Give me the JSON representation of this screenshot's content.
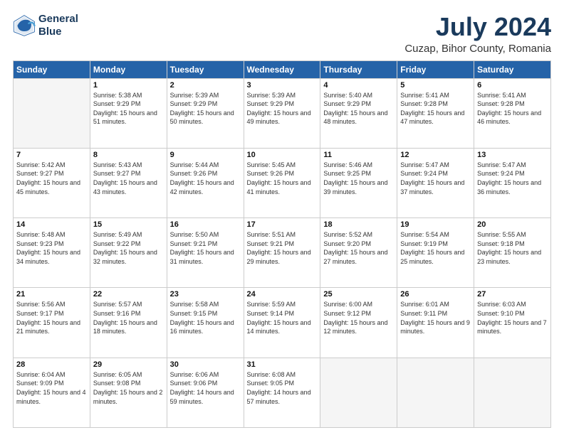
{
  "logo": {
    "line1": "General",
    "line2": "Blue"
  },
  "title": "July 2024",
  "subtitle": "Cuzap, Bihor County, Romania",
  "weekdays": [
    "Sunday",
    "Monday",
    "Tuesday",
    "Wednesday",
    "Thursday",
    "Friday",
    "Saturday"
  ],
  "weeks": [
    [
      {
        "day": "",
        "sunrise": "",
        "sunset": "",
        "daylight": ""
      },
      {
        "day": "1",
        "sunrise": "Sunrise: 5:38 AM",
        "sunset": "Sunset: 9:29 PM",
        "daylight": "Daylight: 15 hours and 51 minutes."
      },
      {
        "day": "2",
        "sunrise": "Sunrise: 5:39 AM",
        "sunset": "Sunset: 9:29 PM",
        "daylight": "Daylight: 15 hours and 50 minutes."
      },
      {
        "day": "3",
        "sunrise": "Sunrise: 5:39 AM",
        "sunset": "Sunset: 9:29 PM",
        "daylight": "Daylight: 15 hours and 49 minutes."
      },
      {
        "day": "4",
        "sunrise": "Sunrise: 5:40 AM",
        "sunset": "Sunset: 9:29 PM",
        "daylight": "Daylight: 15 hours and 48 minutes."
      },
      {
        "day": "5",
        "sunrise": "Sunrise: 5:41 AM",
        "sunset": "Sunset: 9:28 PM",
        "daylight": "Daylight: 15 hours and 47 minutes."
      },
      {
        "day": "6",
        "sunrise": "Sunrise: 5:41 AM",
        "sunset": "Sunset: 9:28 PM",
        "daylight": "Daylight: 15 hours and 46 minutes."
      }
    ],
    [
      {
        "day": "7",
        "sunrise": "Sunrise: 5:42 AM",
        "sunset": "Sunset: 9:27 PM",
        "daylight": "Daylight: 15 hours and 45 minutes."
      },
      {
        "day": "8",
        "sunrise": "Sunrise: 5:43 AM",
        "sunset": "Sunset: 9:27 PM",
        "daylight": "Daylight: 15 hours and 43 minutes."
      },
      {
        "day": "9",
        "sunrise": "Sunrise: 5:44 AM",
        "sunset": "Sunset: 9:26 PM",
        "daylight": "Daylight: 15 hours and 42 minutes."
      },
      {
        "day": "10",
        "sunrise": "Sunrise: 5:45 AM",
        "sunset": "Sunset: 9:26 PM",
        "daylight": "Daylight: 15 hours and 41 minutes."
      },
      {
        "day": "11",
        "sunrise": "Sunrise: 5:46 AM",
        "sunset": "Sunset: 9:25 PM",
        "daylight": "Daylight: 15 hours and 39 minutes."
      },
      {
        "day": "12",
        "sunrise": "Sunrise: 5:47 AM",
        "sunset": "Sunset: 9:24 PM",
        "daylight": "Daylight: 15 hours and 37 minutes."
      },
      {
        "day": "13",
        "sunrise": "Sunrise: 5:47 AM",
        "sunset": "Sunset: 9:24 PM",
        "daylight": "Daylight: 15 hours and 36 minutes."
      }
    ],
    [
      {
        "day": "14",
        "sunrise": "Sunrise: 5:48 AM",
        "sunset": "Sunset: 9:23 PM",
        "daylight": "Daylight: 15 hours and 34 minutes."
      },
      {
        "day": "15",
        "sunrise": "Sunrise: 5:49 AM",
        "sunset": "Sunset: 9:22 PM",
        "daylight": "Daylight: 15 hours and 32 minutes."
      },
      {
        "day": "16",
        "sunrise": "Sunrise: 5:50 AM",
        "sunset": "Sunset: 9:21 PM",
        "daylight": "Daylight: 15 hours and 31 minutes."
      },
      {
        "day": "17",
        "sunrise": "Sunrise: 5:51 AM",
        "sunset": "Sunset: 9:21 PM",
        "daylight": "Daylight: 15 hours and 29 minutes."
      },
      {
        "day": "18",
        "sunrise": "Sunrise: 5:52 AM",
        "sunset": "Sunset: 9:20 PM",
        "daylight": "Daylight: 15 hours and 27 minutes."
      },
      {
        "day": "19",
        "sunrise": "Sunrise: 5:54 AM",
        "sunset": "Sunset: 9:19 PM",
        "daylight": "Daylight: 15 hours and 25 minutes."
      },
      {
        "day": "20",
        "sunrise": "Sunrise: 5:55 AM",
        "sunset": "Sunset: 9:18 PM",
        "daylight": "Daylight: 15 hours and 23 minutes."
      }
    ],
    [
      {
        "day": "21",
        "sunrise": "Sunrise: 5:56 AM",
        "sunset": "Sunset: 9:17 PM",
        "daylight": "Daylight: 15 hours and 21 minutes."
      },
      {
        "day": "22",
        "sunrise": "Sunrise: 5:57 AM",
        "sunset": "Sunset: 9:16 PM",
        "daylight": "Daylight: 15 hours and 18 minutes."
      },
      {
        "day": "23",
        "sunrise": "Sunrise: 5:58 AM",
        "sunset": "Sunset: 9:15 PM",
        "daylight": "Daylight: 15 hours and 16 minutes."
      },
      {
        "day": "24",
        "sunrise": "Sunrise: 5:59 AM",
        "sunset": "Sunset: 9:14 PM",
        "daylight": "Daylight: 15 hours and 14 minutes."
      },
      {
        "day": "25",
        "sunrise": "Sunrise: 6:00 AM",
        "sunset": "Sunset: 9:12 PM",
        "daylight": "Daylight: 15 hours and 12 minutes."
      },
      {
        "day": "26",
        "sunrise": "Sunrise: 6:01 AM",
        "sunset": "Sunset: 9:11 PM",
        "daylight": "Daylight: 15 hours and 9 minutes."
      },
      {
        "day": "27",
        "sunrise": "Sunrise: 6:03 AM",
        "sunset": "Sunset: 9:10 PM",
        "daylight": "Daylight: 15 hours and 7 minutes."
      }
    ],
    [
      {
        "day": "28",
        "sunrise": "Sunrise: 6:04 AM",
        "sunset": "Sunset: 9:09 PM",
        "daylight": "Daylight: 15 hours and 4 minutes."
      },
      {
        "day": "29",
        "sunrise": "Sunrise: 6:05 AM",
        "sunset": "Sunset: 9:08 PM",
        "daylight": "Daylight: 15 hours and 2 minutes."
      },
      {
        "day": "30",
        "sunrise": "Sunrise: 6:06 AM",
        "sunset": "Sunset: 9:06 PM",
        "daylight": "Daylight: 14 hours and 59 minutes."
      },
      {
        "day": "31",
        "sunrise": "Sunrise: 6:08 AM",
        "sunset": "Sunset: 9:05 PM",
        "daylight": "Daylight: 14 hours and 57 minutes."
      },
      {
        "day": "",
        "sunrise": "",
        "sunset": "",
        "daylight": ""
      },
      {
        "day": "",
        "sunrise": "",
        "sunset": "",
        "daylight": ""
      },
      {
        "day": "",
        "sunrise": "",
        "sunset": "",
        "daylight": ""
      }
    ]
  ]
}
